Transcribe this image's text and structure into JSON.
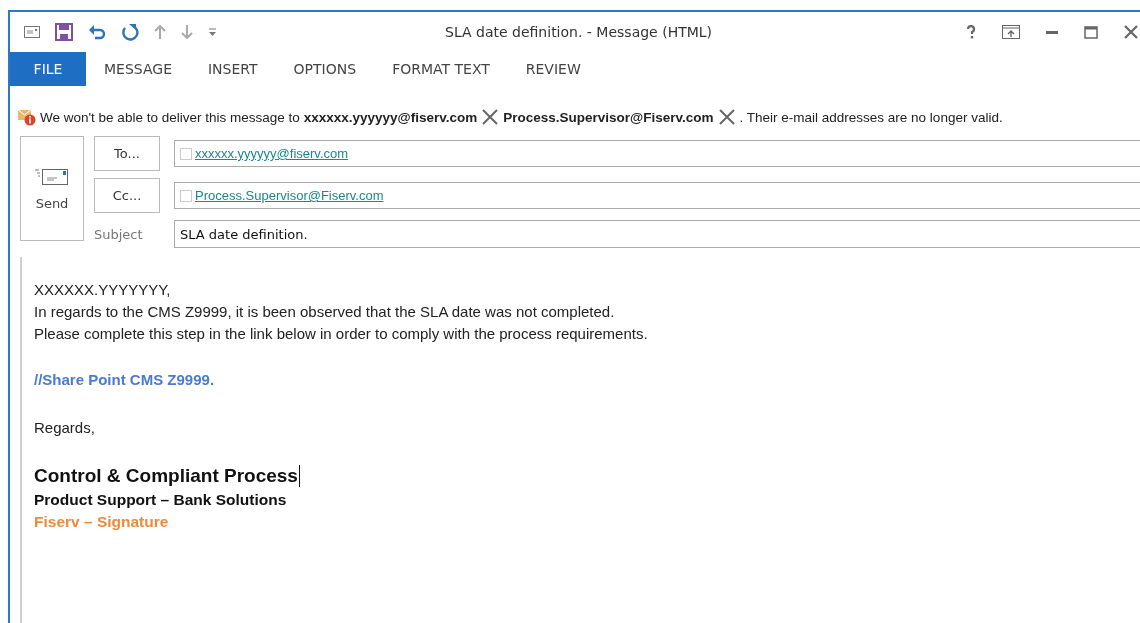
{
  "window": {
    "title": "SLA date definition. - Message (HTML)"
  },
  "tabs": [
    {
      "label": "FILE",
      "selected": true
    },
    {
      "label": "MESSAGE",
      "selected": false
    },
    {
      "label": "INSERT",
      "selected": false
    },
    {
      "label": "OPTIONS",
      "selected": false
    },
    {
      "label": "FORMAT TEXT",
      "selected": false
    },
    {
      "label": "REVIEW",
      "selected": false
    }
  ],
  "notice": {
    "lead": "We won't be able to deliver this message to",
    "recipients": [
      "xxxxxx.yyyyyy@fiserv.com",
      "Process.Supervisor@Fiserv.com"
    ],
    "tail": ".  Their e-mail addresses are no longer valid."
  },
  "send_button": "Send",
  "to": {
    "button": "To...",
    "value": "xxxxxx.yyyyyy@fiserv.com"
  },
  "cc": {
    "button": "Cc...",
    "value": "Process.Supervisor@Fiserv.com"
  },
  "subject": {
    "label": "Subject",
    "value": "SLA date definition."
  },
  "body": [
    {
      "kind": "text",
      "text": "XXXXXX.YYYYYYY,"
    },
    {
      "kind": "text",
      "text": "In regards to the CMS Z9999, it is been observed that the SLA date was not completed."
    },
    {
      "kind": "text",
      "text": "Please complete this step in the link below in order to comply with the process requirements."
    },
    {
      "kind": "gap"
    },
    {
      "kind": "link",
      "text": "//Share Point CMS Z9999."
    },
    {
      "kind": "gap"
    },
    {
      "kind": "plain",
      "text": "Regards,"
    },
    {
      "kind": "gap"
    },
    {
      "kind": "sig-name",
      "text": "Control & Compliant Process"
    },
    {
      "kind": "sig-dept",
      "text": "Product Support – Bank Solutions"
    },
    {
      "kind": "sig-brand",
      "text": "Fiserv – Signature"
    }
  ]
}
